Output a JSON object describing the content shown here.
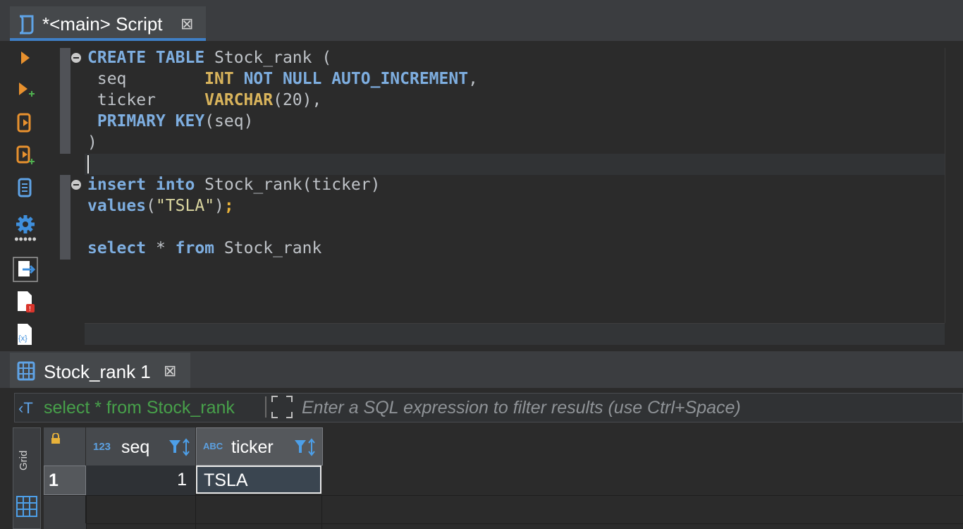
{
  "editor_tab": {
    "title": "*<main> Script",
    "close": "⊠"
  },
  "code": {
    "l1": {
      "k1": "CREATE TABLE",
      "t": " Stock_rank ("
    },
    "l2": {
      "a": " seq        ",
      "k1": "INT",
      "b": " ",
      "k2": "NOT NULL AUTO_INCREMENT",
      "c": ","
    },
    "l3": {
      "a": " ticker     ",
      "k1": "VARCHAR",
      "b": "(20),"
    },
    "l4": {
      "a": " ",
      "k1": "PRIMARY KEY",
      "b": "(seq)"
    },
    "l5": ")",
    "l7": {
      "k1": "insert into",
      "t": " Stock_rank(ticker)"
    },
    "l8": {
      "k1": "values",
      "a": "(",
      "s": "\"TSLA\"",
      "b": ")",
      "sc": ";"
    },
    "l10": {
      "k1": "select",
      "a": " * ",
      "k2": "from",
      "b": " Stock_rank"
    }
  },
  "results_tab": {
    "title": "Stock_rank 1",
    "close": "⊠"
  },
  "filter": {
    "query": "select * from Stock_rank",
    "placeholder": "Enter a SQL expression to filter results (use Ctrl+Space)"
  },
  "grid": {
    "columns": [
      {
        "name": "seq",
        "type_badge": "123"
      },
      {
        "name": "ticker",
        "type_badge": "ABC"
      }
    ],
    "rows": [
      {
        "index": "1",
        "seq": "1",
        "ticker": "TSLA"
      }
    ],
    "side_label": "Grid"
  }
}
